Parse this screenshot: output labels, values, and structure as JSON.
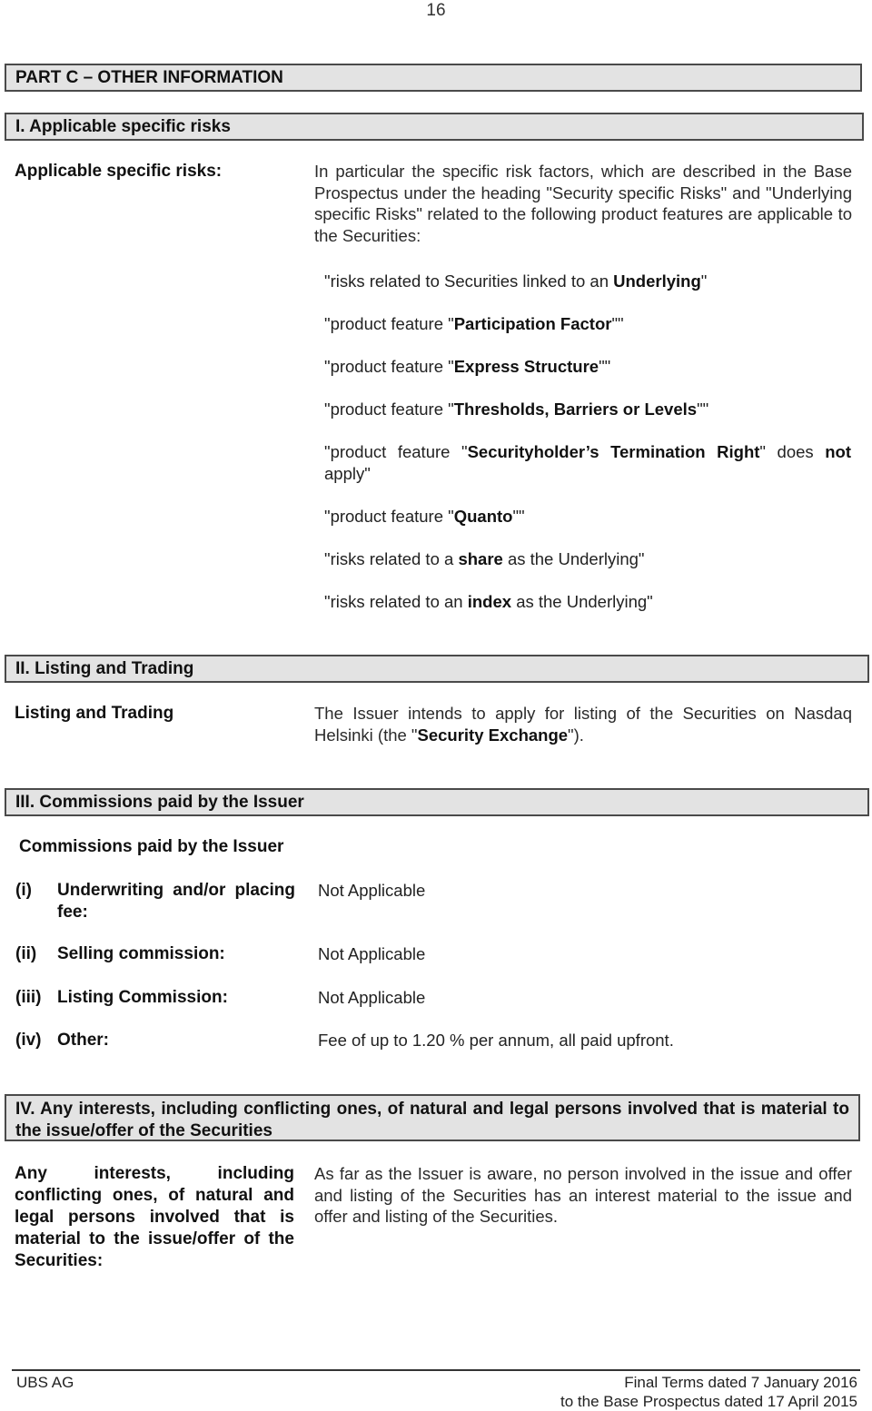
{
  "page_number": "16",
  "part_heading": "PART C – OTHER INFORMATION",
  "sections": {
    "risks": {
      "heading": "I. Applicable specific risks",
      "label": "Applicable specific risks:",
      "intro": "In particular the specific risk factors, which are described in the Base Prospectus under the heading \"Security specific Risks\" and \"Underlying specific Risks\" related to the following product features are applicable to the Securities:",
      "items": [
        {
          "pre": "\"risks related to Securities linked to an ",
          "bold": "Underlying",
          "post": "\""
        },
        {
          "pre": "\"product feature \"",
          "bold": "Participation Factor",
          "post": "\"\""
        },
        {
          "pre": "\"product feature \"",
          "bold": "Express Structure",
          "post": "\"\""
        },
        {
          "pre": "\"product feature \"",
          "bold": "Thresholds, Barriers or Levels",
          "post": "\"\""
        },
        {
          "pre": "\"product feature \"",
          "bold": "Securityholder’s Termination Right",
          "post": "\" does ",
          "bold2": "not",
          "post2": " apply\""
        },
        {
          "pre": "\"product feature \"",
          "bold": "Quanto",
          "post": "\"\""
        },
        {
          "pre": "\"risks related to a ",
          "bold": "share",
          "post": " as the Underlying\""
        },
        {
          "pre": "\"risks related to an ",
          "bold": "index",
          "post": " as the Underlying\""
        }
      ]
    },
    "listing": {
      "heading": "II. Listing and Trading",
      "label": "Listing and Trading",
      "text_pre": "The Issuer intends to apply for listing of the Securities on Nasdaq Helsinki (the \"",
      "text_bold": "Security Exchange",
      "text_post": "\")."
    },
    "commissions": {
      "heading": "III. Commissions paid by the Issuer",
      "subheading": "Commissions paid by the Issuer",
      "rows": [
        {
          "num": "(i)",
          "label": "Underwriting and/or placing fee:",
          "value": "Not Applicable"
        },
        {
          "num": "(ii)",
          "label": "Selling commission:",
          "value": "Not Applicable"
        },
        {
          "num": "(iii)",
          "label": "Listing Commission:",
          "value": "Not Applicable"
        },
        {
          "num": "(iv)",
          "label": "Other:",
          "value": "Fee of up to 1.20 % per annum, all paid upfront."
        }
      ]
    },
    "interests": {
      "heading": "IV. Any interests, including conflicting ones, of natural and legal persons involved that is material to the issue/offer of the Securities",
      "label": "Any interests, including conflicting ones, of natural and legal persons involved that is material to the issue/offer of the Securities:",
      "text": "As far as the Issuer is aware, no person involved in the issue and offer and listing of the Securities has an interest material to the issue and offer and listing of the Securities."
    }
  },
  "footer": {
    "issuer": "UBS AG",
    "line1": "Final Terms dated 7 January 2016",
    "line2": "to the Base Prospectus dated 17 April 2015"
  }
}
